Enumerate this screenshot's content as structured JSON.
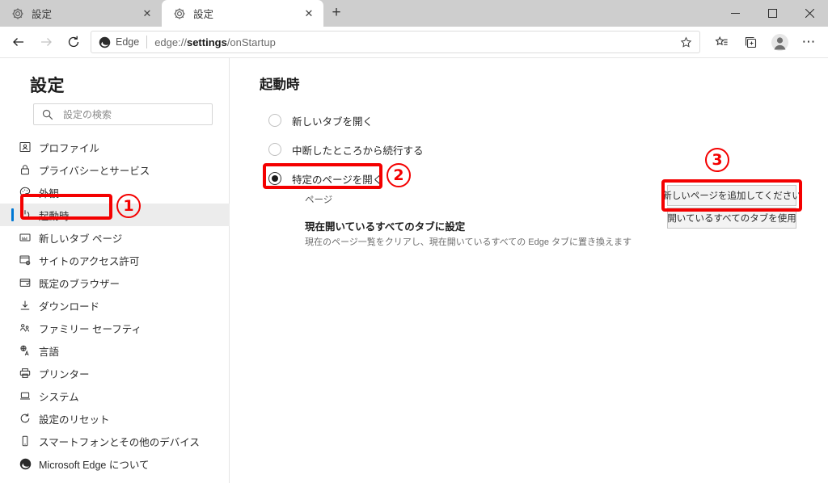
{
  "window": {
    "minimize_label": "─",
    "maximize_label": "□",
    "close_label": "✕"
  },
  "tabs": [
    {
      "title": "設定",
      "favicon": "gear-icon",
      "active": false,
      "close_label": "✕"
    },
    {
      "title": "設定",
      "favicon": "gear-icon",
      "active": true,
      "close_label": "✕"
    }
  ],
  "newtab_label": "+",
  "toolbar": {
    "back_label": "←",
    "forward_label": "→",
    "refresh_label": "↻",
    "edge_badge": "Edge",
    "url_prefix": "edge://",
    "url_bold": "settings",
    "url_suffix": "/onStartup",
    "favorites_icon": "star-icon",
    "collections_icon": "star-list-icon",
    "tabs_icon": "collections-icon",
    "profile_icon": "avatar-icon",
    "more_label": "⋯"
  },
  "sidebar": {
    "title": "設定",
    "search": {
      "placeholder": "設定の検索",
      "icon": "search-icon"
    },
    "items": [
      {
        "label": "プロファイル",
        "icon": "profile-icon",
        "selected": false
      },
      {
        "label": "プライバシーとサービス",
        "icon": "lock-icon",
        "selected": false
      },
      {
        "label": "外観",
        "icon": "palette-icon",
        "selected": false
      },
      {
        "label": "起動時",
        "icon": "power-icon",
        "selected": true
      },
      {
        "label": "新しいタブ ページ",
        "icon": "newtab-page-icon",
        "selected": false
      },
      {
        "label": "サイトのアクセス許可",
        "icon": "site-permissions-icon",
        "selected": false
      },
      {
        "label": "既定のブラウザー",
        "icon": "browser-icon",
        "selected": false
      },
      {
        "label": "ダウンロード",
        "icon": "download-icon",
        "selected": false
      },
      {
        "label": "ファミリー セーフティ",
        "icon": "family-icon",
        "selected": false
      },
      {
        "label": "言語",
        "icon": "language-icon",
        "selected": false
      },
      {
        "label": "プリンター",
        "icon": "printer-icon",
        "selected": false
      },
      {
        "label": "システム",
        "icon": "system-icon",
        "selected": false
      },
      {
        "label": "設定のリセット",
        "icon": "reset-icon",
        "selected": false
      },
      {
        "label": "スマートフォンとその他のデバイス",
        "icon": "phone-icon",
        "selected": false
      },
      {
        "label": "Microsoft Edge について",
        "icon": "edge-logo-icon",
        "selected": false
      }
    ]
  },
  "main": {
    "title": "起動時",
    "radios": [
      {
        "label": "新しいタブを開く",
        "checked": false
      },
      {
        "label": "中断したところから続行する",
        "checked": false
      },
      {
        "label": "特定のページを開く",
        "checked": true
      }
    ],
    "pages_label": "ページ",
    "set_all_tabs_title": "現在開いているすべてのタブに設定",
    "set_all_tabs_desc": "現在のページ一覧をクリアし、現在開いているすべての Edge タブに置き換えます",
    "buttons": [
      {
        "label": "新しいページを追加してください"
      },
      {
        "label": "開いているすべてのタブを使用"
      }
    ]
  },
  "annotations": {
    "accent_color": "#f40000",
    "markers": [
      {
        "number": "①",
        "text": "1"
      },
      {
        "number": "②",
        "text": "2"
      },
      {
        "number": "③",
        "text": "3"
      }
    ]
  }
}
